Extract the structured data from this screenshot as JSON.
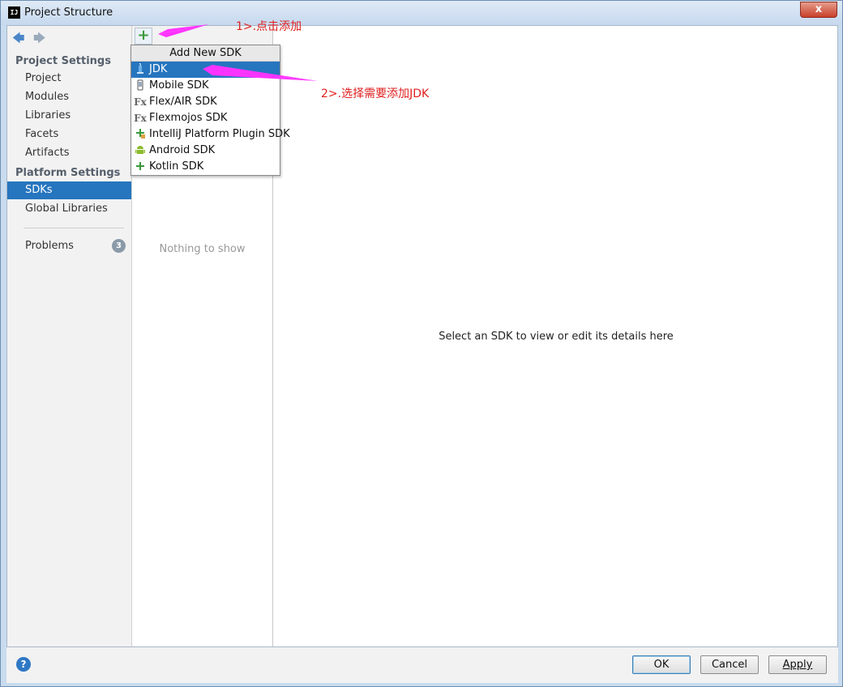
{
  "window": {
    "title": "Project Structure",
    "app_icon_label": "IJ",
    "close_label": "x"
  },
  "sidebar": {
    "back_icon": "arrow-left-icon",
    "forward_icon": "arrow-right-icon",
    "project_settings_header": "Project Settings",
    "project_items": [
      "Project",
      "Modules",
      "Libraries",
      "Facets",
      "Artifacts"
    ],
    "platform_settings_header": "Platform Settings",
    "platform_items": [
      "SDKs",
      "Global Libraries"
    ],
    "selected": "SDKs",
    "problems_label": "Problems",
    "problems_count": "3"
  },
  "list_panel": {
    "add_label": "+",
    "empty_text": "Nothing to show"
  },
  "detail_panel": {
    "placeholder": "Select an SDK to view or edit its details here"
  },
  "dropdown": {
    "header": "Add New SDK",
    "items": [
      "JDK",
      "Mobile SDK",
      "Flex/AIR SDK",
      "Flexmojos SDK",
      "IntelliJ Platform Plugin SDK",
      "Android SDK",
      "Kotlin SDK"
    ],
    "selected": "JDK"
  },
  "footer": {
    "help_label": "?",
    "ok_label": "OK",
    "cancel_label": "Cancel",
    "apply_label": "Apply"
  },
  "annotations": {
    "step1": "1>.点击添加",
    "step2": "2>.选择需要添加JDK"
  },
  "colors": {
    "selection": "#2675bf",
    "annotation_text": "#e02020",
    "annotation_arrow": "#ff33ff"
  }
}
